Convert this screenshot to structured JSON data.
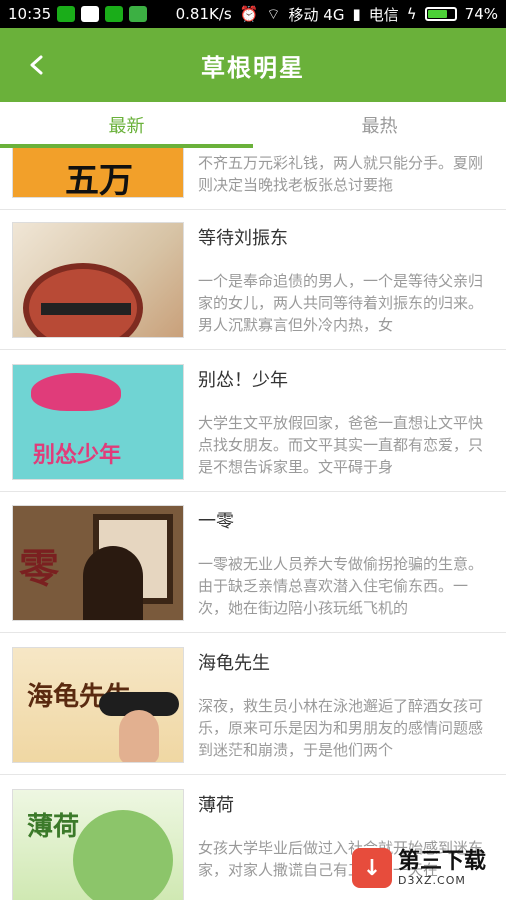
{
  "status_bar": {
    "time": "10:35",
    "speed": "0.81K/s",
    "carrier1": "移动 4G",
    "carrier2": "电信",
    "battery": "74%",
    "battery_level": 0.74
  },
  "header": {
    "title": "草根明星"
  },
  "tabs": [
    {
      "label": "最新"
    },
    {
      "label": "最热"
    }
  ],
  "items": [
    {
      "title": "",
      "desc": "卧底警花何化告诉服务员男友夏刚，如果凑不齐五万元彩礼钱，两人就只能分手。夏刚则决定当晚找老板张总讨要拖",
      "thumb_text": "五万"
    },
    {
      "title": "等待刘振东",
      "desc": "一个是奉命追债的男人，一个是等待父亲归家的女儿，两人共同等待着刘振东的归来。男人沉默寡言但外冷内热，女"
    },
    {
      "title": "别怂！少年",
      "desc": "大学生文平放假回家，爸爸一直想让文平快点找女朋友。而文平其实一直都有恋爱，只是不想告诉家里。文平碍于身",
      "thumb_text": "别怂少年"
    },
    {
      "title": "一零",
      "desc": "一零被无业人员养大专做偷拐抢骗的生意。由于缺乏亲情总喜欢潜入住宅偷东西。一次，她在街边陪小孩玩纸飞机的",
      "thumb_text": "零"
    },
    {
      "title": "海龟先生",
      "desc": "深夜，救生员小林在泳池邂逅了醉酒女孩可乐，原来可乐是因为和男朋友的感情问题感到迷茫和崩溃，于是他们两个",
      "thumb_text": "海龟先生"
    },
    {
      "title": "薄荷",
      "desc": "女孩大学毕业后做过入社会就开始感到迷东家，对家人撒谎自己有工作。一天在",
      "thumb_text": "薄荷"
    }
  ],
  "watermark": {
    "cn": "第三下载",
    "en": "D3XZ.COM"
  },
  "colors": {
    "accent": "#6ab13a",
    "muted": "#9a9a9a"
  }
}
